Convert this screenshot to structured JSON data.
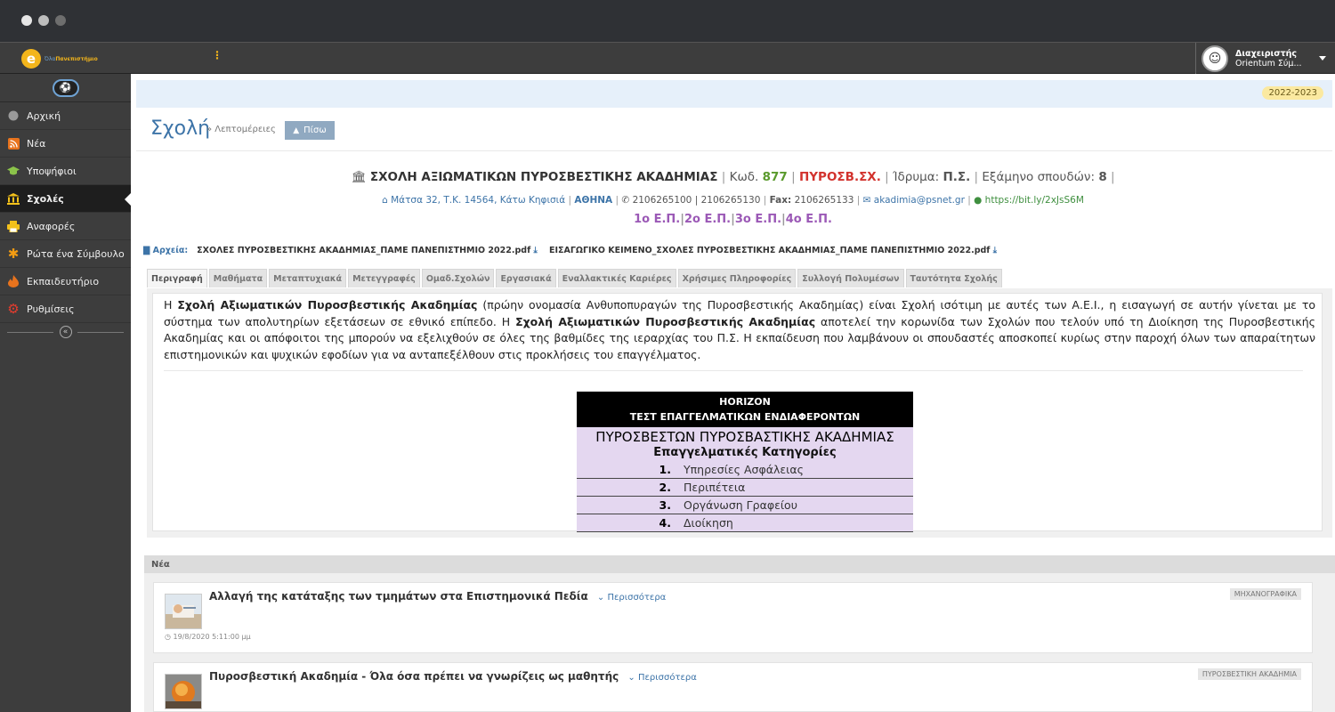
{
  "topbar": {
    "logo_e": "e",
    "logo_name_light": "Όλα",
    "logo_name": "Πανεπιστήμιο",
    "menu_dots": "⋮",
    "user": {
      "role": "Διαχειριστής",
      "name": "Orientum Σύμ..."
    }
  },
  "sidebar": {
    "items": [
      {
        "label": "Αρχική",
        "icon": "circle-icon",
        "color": "#9a9a9a"
      },
      {
        "label": "Νέα",
        "icon": "rss-icon",
        "color": "#e8731d"
      },
      {
        "label": "Υποψήφιοι",
        "icon": "graduation-cap-icon",
        "color": "#8bc34a"
      },
      {
        "label": "Σχολές",
        "icon": "institution-icon",
        "color": "#f3c11b"
      },
      {
        "label": "Αναφορές",
        "icon": "print-icon",
        "color": "#f3c11b"
      },
      {
        "label": "Ρώτα ένα Σύμβουλο",
        "icon": "asterisk-icon",
        "color": "#f39c12"
      },
      {
        "label": "Εκπαιδευτήριο",
        "icon": "fire-icon",
        "color": "#e8731d"
      },
      {
        "label": "Ρυθμίσεις",
        "icon": "gear-icon",
        "color": "#e63c2e"
      }
    ]
  },
  "main": {
    "year_badge": "2022-2023",
    "page_title": "Σχολή",
    "breadcrumb": "» Λεπτομέρειες",
    "back_label": "Πίσω",
    "school": {
      "name": "ΣΧΟΛΗ ΑΞΙΩΜΑΤΙΚΩΝ ΠΥΡΟΣΒΕΣΤΙΚΗΣ ΑΚΑΔΗΜΙΑΣ",
      "code_label": "Κωδ.",
      "code": "877",
      "abbr": "ΠΥΡΟΣΒ.ΣΧ.",
      "institution_label": "Ίδρυμα:",
      "institution": "Π.Σ.",
      "semesters_label": "Εξάμηνο σπουδών:",
      "semesters": "8",
      "address": "Μάτσα 32, Τ.Κ. 14564, Κάτω Κηφισιά",
      "city": "ΑΘΗΝΑ",
      "phones": "2106265100 | 2106265130",
      "fax_label": "Fax:",
      "fax": "2106265133",
      "email": "akadimia@psnet.gr",
      "url": "https://bit.ly/2xJsS6M",
      "ep": [
        "1ο Ε.Π.",
        "2ο Ε.Π.",
        "3ο Ε.Π.",
        "4ο Ε.Π."
      ]
    },
    "files": {
      "label": "Αρχεία:",
      "items": [
        "ΣΧΟΛΕΣ ΠΥΡΟΣΒΕΣΤΙΚΗΣ ΑΚΑΔΗΜΙΑΣ_ΠΑΜΕ ΠΑΝΕΠΙΣΤΗΜΙΟ 2022.pdf",
        "ΕΙΣΑΓΩΓΙΚΟ ΚΕΙΜΕΝΟ_ΣΧΟΛΕΣ ΠΥΡΟΣΒΕΣΤΙΚΗΣ ΑΚΑΔΗΜΙΑΣ_ΠΑΜΕ ΠΑΝΕΠΙΣΤΗΜΙΟ 2022.pdf"
      ]
    },
    "tabs": [
      "Περιγραφή",
      "Μαθήματα",
      "Μεταπτυχιακά",
      "Μετεγγραφές",
      "Ομαδ.Σχολών",
      "Εργασιακά",
      "Εναλλακτικές Καριέρες",
      "Χρήσιμες Πληροφορίες",
      "Συλλογή Πολυμέσων",
      "Ταυτότητα Σχολής"
    ],
    "description": {
      "p1": "Η ",
      "b1": "Σχολή Αξιωματικών Πυροσβεστικής Ακαδημίας",
      "p2": " (πρώην ονομασία Ανθυποπυραγών της Πυροσβεστικής Ακαδημίας) είναι Σχολή ισότιμη με αυτές των Α.Ε.Ι., η εισαγωγή σε αυτήν γίνεται με το σύστημα των απολυτηρίων εξετάσεων σε εθνικό επίπεδο. Η ",
      "b2": "Σχολή Αξιωματικών Πυροσβεστικής Ακαδημίας",
      "p3": " αποτελεί την κορωνίδα των Σχολών που τελούν υπό τη Διοίκηση της Πυροσβεστικής Ακαδημίας και οι απόφοιτοι της μπορούν να εξελιχθούν σε όλες της βαθμίδες της ιεραρχίας του Π.Σ. Η εκπαίδευση που λαμβάνουν οι σπουδαστές αποσκοπεί κυρίως στην παροχή όλων των απαραίτητων επιστημονικών και ψυχικών εφοδίων για να ανταπεξέλθουν στις προκλήσεις του επαγγέλματος."
    },
    "horizon": {
      "head1": "HORIZON",
      "head2": "ΤΕΣΤ ΕΠΑΓΓΕΛΜΑΤΙΚΩΝ ΕΝΔΙΑΦΕΡΟΝΤΩΝ",
      "title": "ΠΥΡΟΣΒΕΣΤΩΝ ΠΥΡΟΣΒΑΣΤΙΚΗΣ ΑΚΑΔΗΜΙΑΣ",
      "subtitle": "Επαγγελματικές Κατηγορίες",
      "items": [
        {
          "n": "1.",
          "label": "Υπηρεσίες Ασφάλειας"
        },
        {
          "n": "2.",
          "label": "Περιπέτεια"
        },
        {
          "n": "3.",
          "label": "Οργάνωση Γραφείου"
        },
        {
          "n": "4.",
          "label": "Διοίκηση"
        }
      ]
    },
    "news": {
      "header": "Νέα",
      "items": [
        {
          "title": "Αλλαγή της κατάταξης των τμημάτων στα Επιστημονικά Πεδία",
          "more": "Περισσότερα",
          "tag": "ΜΗΧΑΝΟΓΡΑΦΙΚΑ",
          "date": "19/8/2020 5:11:00 μμ"
        },
        {
          "title": "Πυροσβεστική Ακαδημία - Όλα όσα πρέπει να γνωρίζεις ως μαθητής",
          "more": "Περισσότερα",
          "tag": "ΠΥΡΟΣΒΕΣΤΙΚΗ ΑΚΑΔΗΜΙΑ",
          "date": ""
        }
      ]
    }
  }
}
